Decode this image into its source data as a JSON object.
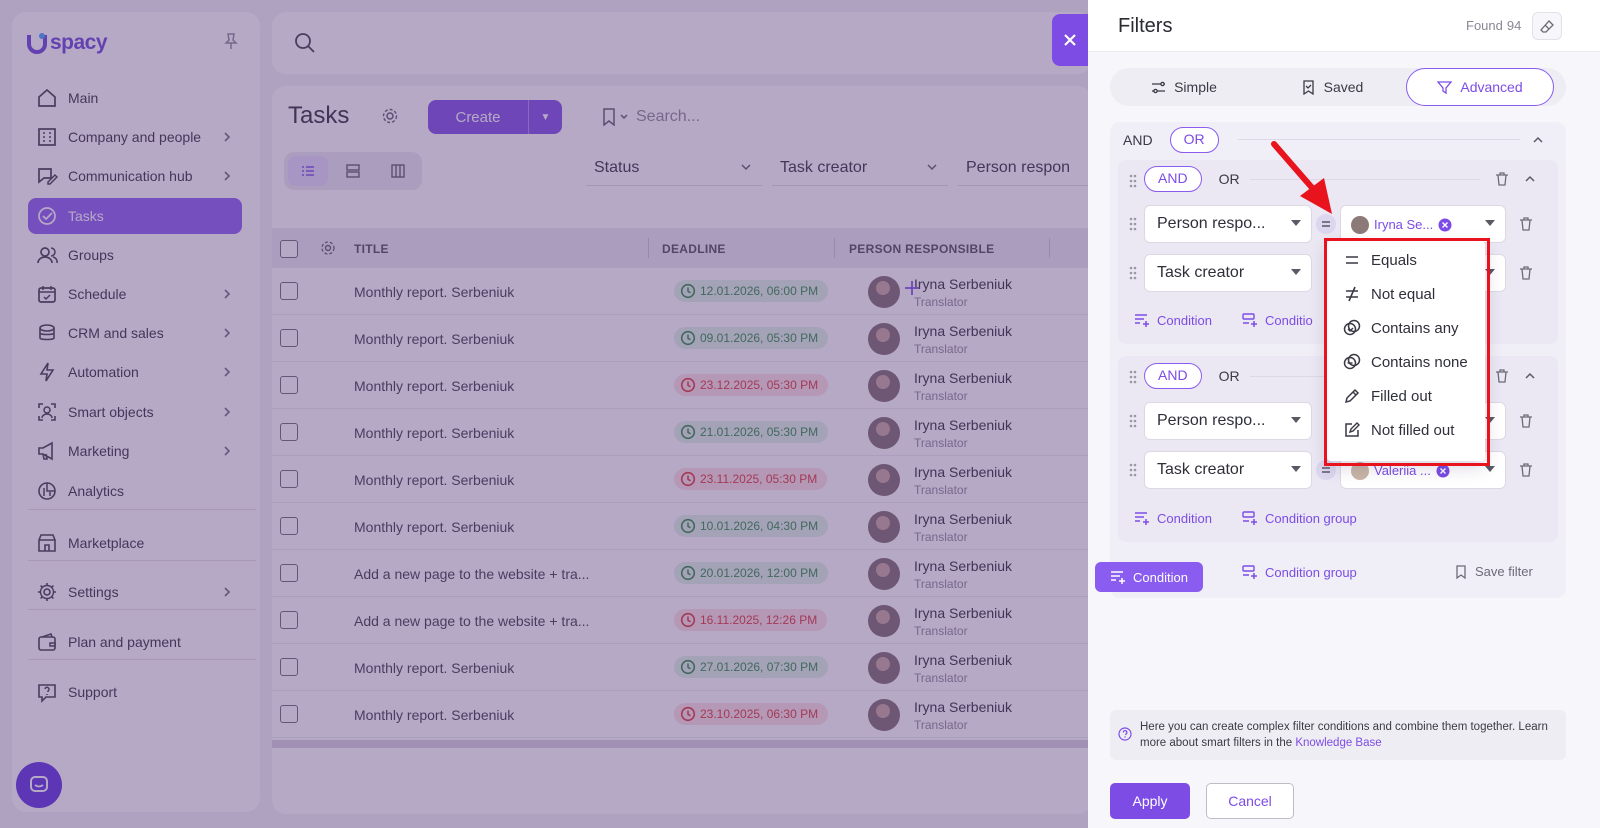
{
  "app": {
    "logo_text": "spacy",
    "brand_color": "#7c4ce5",
    "highlight_color": "#e8131d"
  },
  "sidebar": {
    "items": [
      {
        "label": "Main",
        "icon": "home-icon"
      },
      {
        "label": "Company and people",
        "icon": "building-icon"
      },
      {
        "label": "Communication hub",
        "icon": "chat-edit-icon"
      },
      {
        "label": "Tasks",
        "icon": "check-circle-icon"
      },
      {
        "label": "Groups",
        "icon": "users-icon"
      },
      {
        "label": "Schedule",
        "icon": "calendar-icon"
      },
      {
        "label": "CRM and sales",
        "icon": "coins-icon"
      },
      {
        "label": "Automation",
        "icon": "lightning-icon"
      },
      {
        "label": "Smart objects",
        "icon": "smart-object-icon"
      },
      {
        "label": "Marketing",
        "icon": "megaphone-icon"
      },
      {
        "label": "Analytics",
        "icon": "pie-chart-icon"
      },
      {
        "label": "Marketplace",
        "icon": "store-icon"
      },
      {
        "label": "Settings",
        "icon": "gear-icon"
      },
      {
        "label": "Plan and payment",
        "icon": "wallet-icon"
      },
      {
        "label": "Support",
        "icon": "help-chat-icon"
      }
    ]
  },
  "tasks": {
    "title": "Tasks",
    "create_label": "Create",
    "search_placeholder": "Search...",
    "filters": [
      "Status",
      "Task creator",
      "Person respon"
    ],
    "columns": [
      "TITLE",
      "DEADLINE",
      "PERSON RESPONSIBLE"
    ],
    "rows": [
      {
        "title": "Monthly report. Serbeniuk",
        "deadline": "12.01.2026, 06:00 PM",
        "status": "green",
        "person": "Iryna Serbeniuk",
        "role": "Translator"
      },
      {
        "title": "Monthly report. Serbeniuk",
        "deadline": "09.01.2026, 05:30 PM",
        "status": "green",
        "person": "Iryna Serbeniuk",
        "role": "Translator"
      },
      {
        "title": "Monthly report. Serbeniuk",
        "deadline": "23.12.2025, 05:30 PM",
        "status": "red",
        "person": "Iryna Serbeniuk",
        "role": "Translator"
      },
      {
        "title": "Monthly report. Serbeniuk",
        "deadline": "21.01.2026, 05:30 PM",
        "status": "green",
        "person": "Iryna Serbeniuk",
        "role": "Translator"
      },
      {
        "title": "Monthly report. Serbeniuk",
        "deadline": "23.11.2025, 05:30 PM",
        "status": "red",
        "person": "Iryna Serbeniuk",
        "role": "Translator"
      },
      {
        "title": "Monthly report. Serbeniuk",
        "deadline": "10.01.2026, 04:30 PM",
        "status": "green",
        "person": "Iryna Serbeniuk",
        "role": "Translator"
      },
      {
        "title": "Add a new page to the website + tra...",
        "deadline": "20.01.2026, 12:00 PM",
        "status": "green",
        "person": "Iryna Serbeniuk",
        "role": "Translator"
      },
      {
        "title": "Add a new page to the website + tra...",
        "deadline": "16.11.2025, 12:26 PM",
        "status": "red",
        "person": "Iryna Serbeniuk",
        "role": "Translator"
      },
      {
        "title": "Monthly report. Serbeniuk",
        "deadline": "27.01.2026, 07:30 PM",
        "status": "green",
        "person": "Iryna Serbeniuk",
        "role": "Translator"
      },
      {
        "title": "Monthly report. Serbeniuk",
        "deadline": "23.10.2025, 06:30 PM",
        "status": "red",
        "person": "Iryna Serbeniuk",
        "role": "Translator"
      }
    ]
  },
  "filters_panel": {
    "title": "Filters",
    "found_label": "Found",
    "found_count": "94",
    "tabs": [
      "Simple",
      "Saved",
      "Advanced"
    ],
    "and_label": "AND",
    "or_label": "OR",
    "group1": {
      "cond1_field": "Person respo...",
      "cond1_value": "Iryna Se...",
      "cond2_field": "Task creator"
    },
    "group2": {
      "cond1_field": "Person respo...",
      "cond2_field": "Task creator",
      "cond2_value": "Valeriia ..."
    },
    "condition_label": "Condition",
    "condition_group_label": "Condition group",
    "condition_group_short": "Conditio",
    "save_filter_label": "Save filter",
    "info_text": "Here you can create complex filter conditions and combine them together. Learn more about smart filters in the",
    "info_link": "Knowledge Base",
    "apply_label": "Apply",
    "cancel_label": "Cancel"
  },
  "operator_menu": {
    "options": [
      {
        "label": "Equals",
        "icon": "equals-icon"
      },
      {
        "label": "Not equal",
        "icon": "not-equal-icon"
      },
      {
        "label": "Contains any",
        "icon": "contains-any-icon"
      },
      {
        "label": "Contains none",
        "icon": "contains-none-icon"
      },
      {
        "label": "Filled out",
        "icon": "pencil-icon"
      },
      {
        "label": "Not filled out",
        "icon": "edit-box-icon"
      }
    ]
  }
}
